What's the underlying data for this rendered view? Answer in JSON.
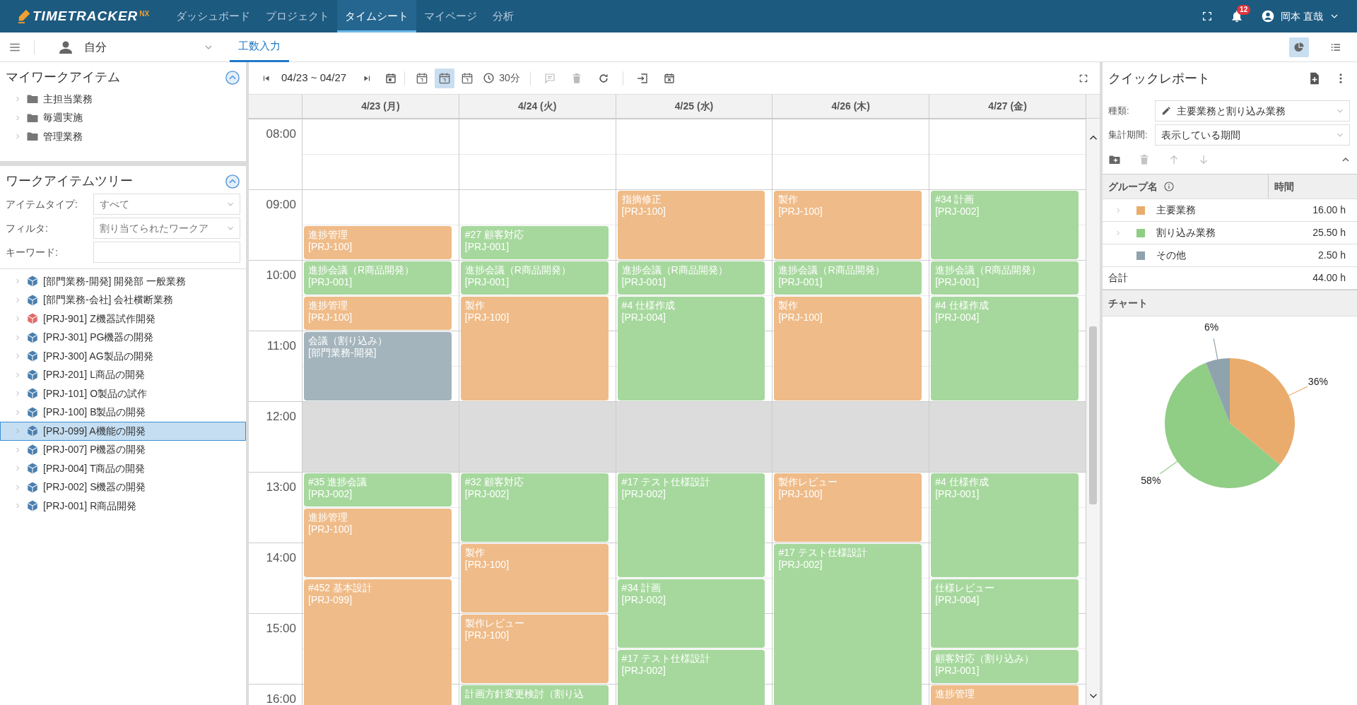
{
  "app": {
    "logo": "TIMETRACKER",
    "logo_suffix": "NX"
  },
  "nav": [
    {
      "label": "ダッシュボード",
      "selected": false
    },
    {
      "label": "プロジェクト",
      "selected": false
    },
    {
      "label": "タイムシート",
      "selected": true
    },
    {
      "label": "マイページ",
      "selected": false
    },
    {
      "label": "分析",
      "selected": false
    }
  ],
  "notifications": {
    "count": "12"
  },
  "user": {
    "name": "岡本 直哉"
  },
  "subbar": {
    "scope": "自分",
    "tabs": [
      {
        "label": "工数入力",
        "selected": true
      }
    ],
    "views": [
      {
        "kind": "chart",
        "selected": true
      },
      {
        "kind": "list",
        "selected": false
      }
    ]
  },
  "my_work_items": {
    "title": "マイワークアイテム",
    "expanded": true,
    "items": [
      {
        "label": "主担当業務"
      },
      {
        "label": "毎週実施"
      },
      {
        "label": "管理業務"
      }
    ]
  },
  "work_item_tree": {
    "title": "ワークアイテムツリー",
    "expanded": true,
    "fields": [
      {
        "label": "アイテムタイプ:",
        "kind": "select",
        "value": "すべて"
      },
      {
        "label": "フィルタ:",
        "kind": "select",
        "value": "割り当てられたワークア"
      },
      {
        "label": "キーワード:",
        "kind": "text"
      }
    ],
    "items": [
      {
        "label": "[部門業務-開発] 開発部 一般業務",
        "color": "#4a7fb0",
        "selected": false
      },
      {
        "label": "[部門業務-会社] 会社横断業務",
        "color": "#4a7fb0",
        "selected": false
      },
      {
        "label": "[PRJ-901] Z機器試作開発",
        "color": "#e06b6b",
        "selected": false
      },
      {
        "label": "[PRJ-301] PG機器の開発",
        "color": "#4a7fb0",
        "selected": false
      },
      {
        "label": "[PRJ-300] AG製品の開発",
        "color": "#4a7fb0",
        "selected": false
      },
      {
        "label": "[PRJ-201] L商品の開発",
        "color": "#4a7fb0",
        "selected": false
      },
      {
        "label": "[PRJ-101] O製品の試作",
        "color": "#4a7fb0",
        "selected": false
      },
      {
        "label": "[PRJ-100] B製品の開発",
        "color": "#4a7fb0",
        "selected": false
      },
      {
        "label": "[PRJ-099] A機能の開発",
        "color": "#4a7fb0",
        "selected": true
      },
      {
        "label": "[PRJ-007] P機器の開発",
        "color": "#4a7fb0",
        "selected": false
      },
      {
        "label": "[PRJ-004] T商品の開発",
        "color": "#4a7fb0",
        "selected": false
      },
      {
        "label": "[PRJ-002] S機器の開発",
        "color": "#4a7fb0",
        "selected": false
      },
      {
        "label": "[PRJ-001] R商品開発",
        "color": "#4a7fb0",
        "selected": false
      }
    ]
  },
  "toolbar": {
    "range": "04/23 ~ 04/27",
    "interval": "30分",
    "view_modes": [
      {
        "selected": false
      },
      {
        "selected": true
      },
      {
        "selected": false
      }
    ],
    "tools": [
      {
        "kind": "comment",
        "disabled": true
      },
      {
        "kind": "delete",
        "disabled": true
      },
      {
        "kind": "refresh",
        "disabled": false
      }
    ]
  },
  "calendar": {
    "hours": [
      "08:00",
      "09:00",
      "10:00",
      "11:00",
      "12:00",
      "13:00",
      "14:00",
      "15:00",
      "16:00"
    ],
    "days": [
      {
        "label": "4/23 (月)",
        "slots": [
          {
            "kind": "free"
          },
          {
            "kind": "free"
          },
          {
            "kind": "free"
          },
          {
            "kind": "event",
            "title": "進捗管理",
            "project": "[PRJ-100]",
            "color": "#efbb88"
          },
          {
            "kind": "event",
            "title": "進捗会議（R商品開発）",
            "project": "[PRJ-001]",
            "color": "#a6d89d"
          },
          {
            "kind": "event",
            "title": "進捗管理",
            "project": "[PRJ-100]",
            "color": "#efbb88"
          },
          {
            "kind": "event",
            "title": "会議（割り込み）",
            "project": "[部門業務-開発]",
            "color": "#a4b4bc"
          },
          {
            "kind": "continued"
          },
          {
            "kind": "break"
          },
          {
            "kind": "break"
          },
          {
            "kind": "event",
            "title": "#35 進捗会議",
            "project": "[PRJ-002]",
            "color": "#a6d89d"
          },
          {
            "kind": "event",
            "title": "進捗管理",
            "project": "[PRJ-100]",
            "color": "#efbb88"
          },
          {
            "kind": "continued"
          },
          {
            "kind": "event",
            "title": "#452 基本設計",
            "project": "[PRJ-099]",
            "color": "#efbb88"
          },
          {
            "kind": "continued"
          },
          {
            "kind": "continued"
          },
          {
            "kind": "continued"
          }
        ]
      },
      {
        "label": "4/24 (火)",
        "slots": [
          {
            "kind": "free"
          },
          {
            "kind": "free"
          },
          {
            "kind": "free"
          },
          {
            "kind": "event",
            "title": "#27 顧客対応",
            "project": "[PRJ-001]",
            "color": "#a6d89d"
          },
          {
            "kind": "event",
            "title": "進捗会議（R商品開発）",
            "project": "[PRJ-001]",
            "color": "#a6d89d"
          },
          {
            "kind": "event",
            "title": "製作",
            "project": "[PRJ-100]",
            "color": "#efbb88"
          },
          {
            "kind": "continued"
          },
          {
            "kind": "continued"
          },
          {
            "kind": "break"
          },
          {
            "kind": "break"
          },
          {
            "kind": "event",
            "title": "#32 顧客対応",
            "project": "[PRJ-002]",
            "color": "#a6d89d"
          },
          {
            "kind": "continued"
          },
          {
            "kind": "event",
            "title": "製作",
            "project": "[PRJ-100]",
            "color": "#efbb88"
          },
          {
            "kind": "continued"
          },
          {
            "kind": "event",
            "title": "製作レビュー",
            "project": "[PRJ-100]",
            "color": "#efbb88"
          },
          {
            "kind": "continued"
          },
          {
            "kind": "event",
            "title": "計画方針変更検討（割り込",
            "color": "#a6d89d"
          }
        ]
      },
      {
        "label": "4/25 (水)",
        "slots": [
          {
            "kind": "free"
          },
          {
            "kind": "free"
          },
          {
            "kind": "event",
            "title": "指摘修正",
            "project": "[PRJ-100]",
            "color": "#efbb88"
          },
          {
            "kind": "continued"
          },
          {
            "kind": "event",
            "title": "進捗会議（R商品開発）",
            "project": "[PRJ-001]",
            "color": "#a6d89d"
          },
          {
            "kind": "event",
            "title": "#4 仕様作成",
            "project": "[PRJ-004]",
            "color": "#a6d89d"
          },
          {
            "kind": "continued"
          },
          {
            "kind": "continued"
          },
          {
            "kind": "break"
          },
          {
            "kind": "break"
          },
          {
            "kind": "event",
            "title": "#17 テスト仕様設計",
            "project": "[PRJ-002]",
            "color": "#a6d89d"
          },
          {
            "kind": "continued"
          },
          {
            "kind": "continued"
          },
          {
            "kind": "event",
            "title": "#34 計画",
            "project": "[PRJ-002]",
            "color": "#a6d89d"
          },
          {
            "kind": "continued"
          },
          {
            "kind": "event",
            "title": "#17 テスト仕様設計",
            "project": "[PRJ-002]",
            "color": "#a6d89d"
          },
          {
            "kind": "continued"
          }
        ]
      },
      {
        "label": "4/26 (木)",
        "slots": [
          {
            "kind": "free"
          },
          {
            "kind": "free"
          },
          {
            "kind": "event",
            "title": "製作",
            "project": "[PRJ-100]",
            "color": "#efbb88"
          },
          {
            "kind": "continued"
          },
          {
            "kind": "event",
            "title": "進捗会議（R商品開発）",
            "project": "[PRJ-001]",
            "color": "#a6d89d"
          },
          {
            "kind": "event",
            "title": "製作",
            "project": "[PRJ-100]",
            "color": "#efbb88"
          },
          {
            "kind": "continued"
          },
          {
            "kind": "continued"
          },
          {
            "kind": "break"
          },
          {
            "kind": "break"
          },
          {
            "kind": "event",
            "title": "製作レビュー",
            "project": "[PRJ-100]",
            "color": "#efbb88"
          },
          {
            "kind": "continued"
          },
          {
            "kind": "event",
            "title": "#17 テスト仕様設計",
            "project": "[PRJ-002]",
            "color": "#a6d89d"
          },
          {
            "kind": "continued"
          },
          {
            "kind": "continued"
          },
          {
            "kind": "continued"
          },
          {
            "kind": "continued"
          }
        ]
      },
      {
        "label": "4/27 (金)",
        "slots": [
          {
            "kind": "free"
          },
          {
            "kind": "free"
          },
          {
            "kind": "event",
            "title": "#34 計画",
            "project": "[PRJ-002]",
            "color": "#a6d89d"
          },
          {
            "kind": "continued"
          },
          {
            "kind": "event",
            "title": "進捗会議（R商品開発）",
            "project": "[PRJ-001]",
            "color": "#a6d89d"
          },
          {
            "kind": "event",
            "title": "#4 仕様作成",
            "project": "[PRJ-004]",
            "color": "#a6d89d"
          },
          {
            "kind": "continued"
          },
          {
            "kind": "continued"
          },
          {
            "kind": "break"
          },
          {
            "kind": "break"
          },
          {
            "kind": "event",
            "title": "#4 仕様作成",
            "project": "[PRJ-001]",
            "color": "#a6d89d"
          },
          {
            "kind": "continued"
          },
          {
            "kind": "continued"
          },
          {
            "kind": "event",
            "title": "仕様レビュー",
            "project": "[PRJ-004]",
            "color": "#a6d89d"
          },
          {
            "kind": "continued"
          },
          {
            "kind": "event",
            "title": "顧客対応（割り込み）",
            "project": "[PRJ-001]",
            "color": "#a6d89d"
          },
          {
            "kind": "event",
            "title": "進捗管理",
            "color": "#efbb88"
          }
        ]
      }
    ]
  },
  "quick_report": {
    "title": "クイックレポート",
    "fields": [
      {
        "label": "種類:",
        "value": "主要業務と割り込み業務",
        "kind": "edit"
      },
      {
        "label": "集計期間:",
        "value": "表示している期間",
        "kind": "plain"
      }
    ],
    "tools": [
      {
        "kind": "add-folder",
        "disabled": false
      },
      {
        "kind": "delete",
        "disabled": true
      },
      {
        "kind": "up",
        "disabled": true
      },
      {
        "kind": "down",
        "disabled": true
      }
    ],
    "columns": [
      "グループ名",
      "時間"
    ],
    "rows": [
      {
        "name": "主要業務",
        "hours": "16.00 h",
        "color": "#eaac6c",
        "expandable": true
      },
      {
        "name": "割り込み業務",
        "hours": "25.50 h",
        "color": "#90cd85",
        "expandable": true
      },
      {
        "name": "その他",
        "hours": "2.50 h",
        "color": "#8fa3ad",
        "expandable": false
      }
    ],
    "total": {
      "label": "合計",
      "hours": "44.00 h"
    },
    "chart_title": "チャート",
    "chart_data": {
      "type": "pie",
      "values": [
        36,
        58,
        6
      ],
      "value_labels": [
        "36%",
        "58%",
        "6%"
      ]
    }
  }
}
